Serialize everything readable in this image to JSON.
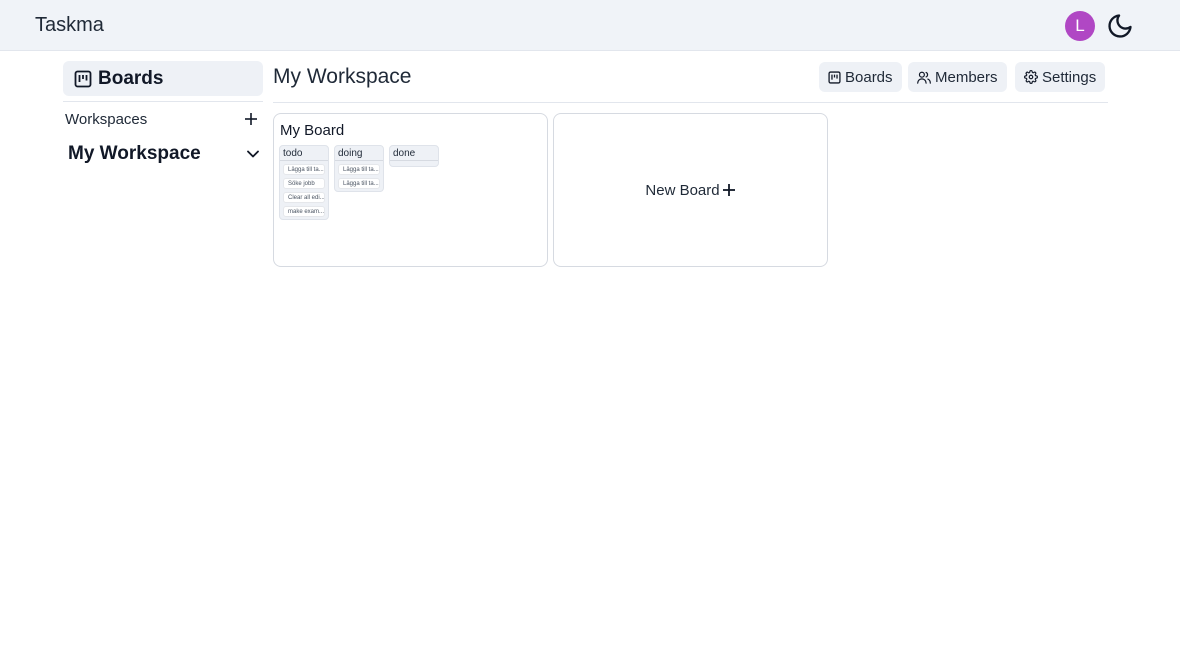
{
  "app": {
    "brand": "Taskma"
  },
  "user": {
    "avatar_initial": "L",
    "avatar_color": "#b047c4"
  },
  "icons": {
    "theme_toggle": "moon-icon",
    "boards": "kanban-icon",
    "members": "users-icon",
    "settings": "gear-icon",
    "add": "plus-icon",
    "expand": "chevron-down-icon"
  },
  "sidebar": {
    "boards_label": "Boards",
    "workspaces_label": "Workspaces",
    "workspace_name": "My Workspace"
  },
  "main": {
    "title": "My Workspace",
    "buttons": {
      "boards": "Boards",
      "members": "Members",
      "settings": "Settings"
    },
    "boards": [
      {
        "title": "My Board",
        "columns": [
          {
            "title": "todo",
            "cards": [
              "Lägga till ta...",
              "Söke jobb",
              "Clear all edi...",
              "make exam..."
            ]
          },
          {
            "title": "doing",
            "cards": [
              "Lägga till ta...",
              "Lägga till ta..."
            ]
          },
          {
            "title": "done",
            "cards": []
          }
        ]
      }
    ],
    "new_board_label": "New Board"
  }
}
